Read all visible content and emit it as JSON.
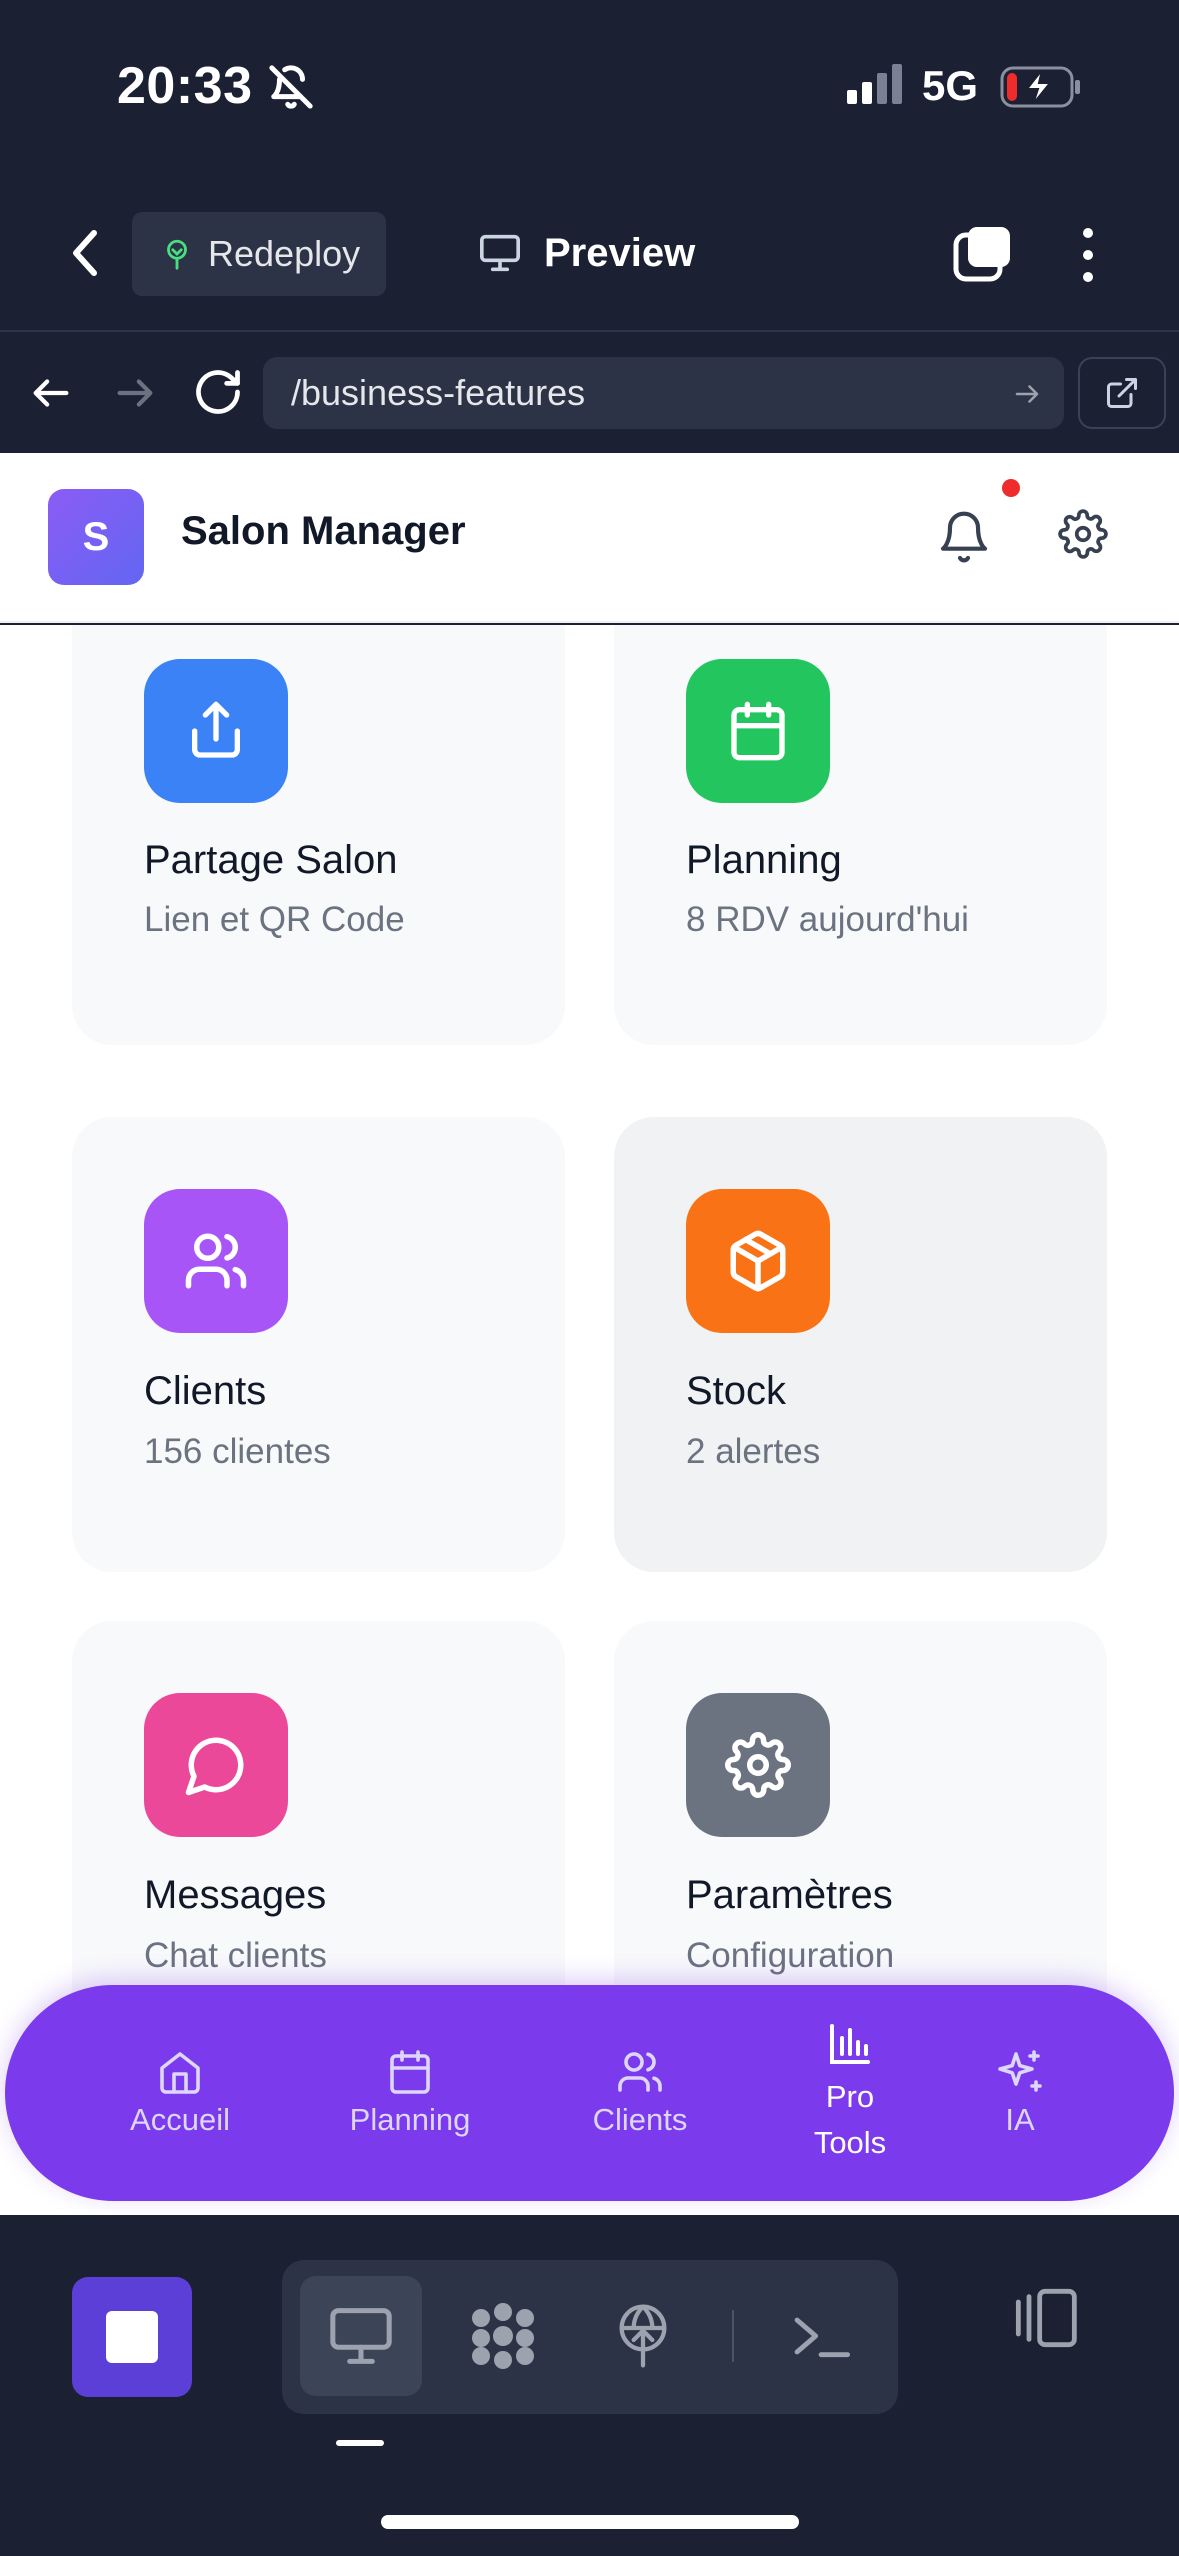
{
  "status_bar": {
    "time": "20:33",
    "network": "5G"
  },
  "browser": {
    "redeploy_label": "Redeploy",
    "preview_label": "Preview",
    "url": "/business-features"
  },
  "app": {
    "avatar_letter": "S",
    "title": "Salon Manager"
  },
  "cards": [
    {
      "title": "Partage Salon",
      "subtitle": "Lien et QR Code",
      "icon": "share-icon",
      "color": "#3b82f6"
    },
    {
      "title": "Planning",
      "subtitle": "8 RDV aujourd'hui",
      "icon": "calendar-icon",
      "color": "#22c55e"
    },
    {
      "title": "Clients",
      "subtitle": "156 clientes",
      "icon": "users-icon",
      "color": "#a855f7"
    },
    {
      "title": "Stock",
      "subtitle": "2 alertes",
      "icon": "package-icon",
      "color": "#f97316"
    },
    {
      "title": "Messages",
      "subtitle": "Chat clients",
      "icon": "message-icon",
      "color": "#ec4899"
    },
    {
      "title": "Paramètres",
      "subtitle": "Configuration",
      "icon": "gear-icon",
      "color": "#6b7280"
    }
  ],
  "bottom_nav": [
    {
      "label": "Accueil",
      "icon": "home-icon"
    },
    {
      "label": "Planning",
      "icon": "calendar-icon"
    },
    {
      "label": "Clients",
      "icon": "users-icon"
    },
    {
      "label": "Pro\nTools",
      "icon": "bar-chart-icon",
      "selected": true
    },
    {
      "label": "IA",
      "icon": "sparkles-icon"
    }
  ],
  "colors": {
    "nav_bg": "#7c3aed",
    "chrome_bg": "#1b2032",
    "notification_dot": "#ef2b2b"
  }
}
